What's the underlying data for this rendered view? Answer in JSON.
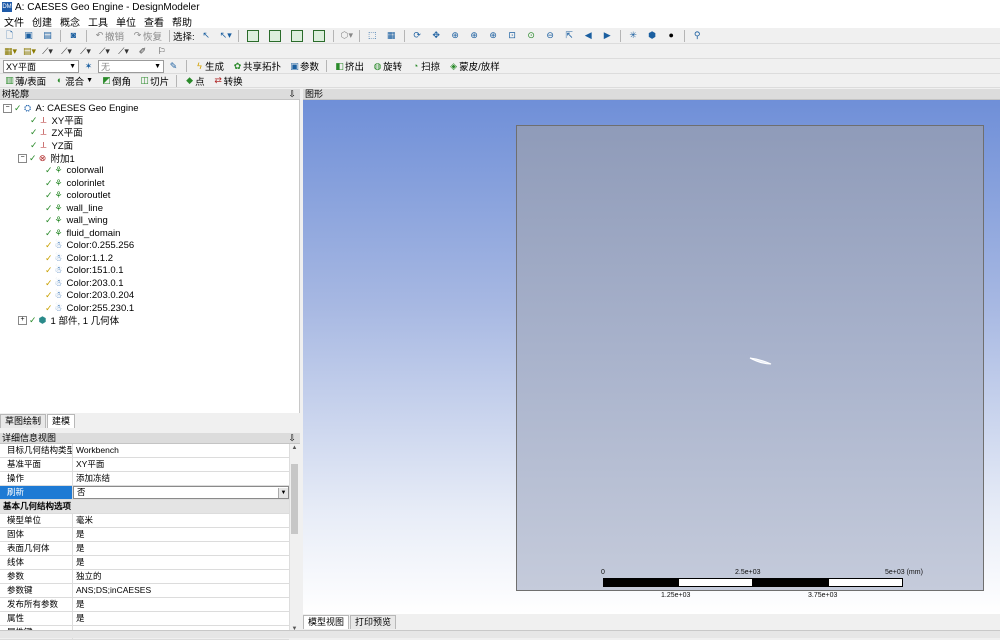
{
  "window": {
    "title": "A: CAESES Geo Engine - DesignModeler",
    "app_icon_text": "DM"
  },
  "menu": [
    "文件",
    "创建",
    "概念",
    "工具",
    "单位",
    "查看",
    "帮助"
  ],
  "toolbar1": {
    "undo_label": "撤销",
    "redo_label": "恢复",
    "select_label": "选择:"
  },
  "toolbar3": {
    "plane_value": "XY平面",
    "sketch_value": "无",
    "generate_label": "生成",
    "share_topology_label": "共享拓扑",
    "parameters_label": "参数",
    "extrude_label": "挤出",
    "revolve_label": "旋转",
    "sweep_label": "扫掠",
    "skin_loft_label": "蒙皮/放样"
  },
  "toolbar4": {
    "thin_surface_label": "薄/表面",
    "blend_label": "混合",
    "chamfer_label": "倒角",
    "slice_label": "切片",
    "point_label": "点",
    "convert_label": "转换"
  },
  "tree": {
    "header": "树轮廓",
    "root": "A: CAESES Geo Engine",
    "planes": [
      "XY平面",
      "ZX平面",
      "YZ面"
    ],
    "attach": "附加1",
    "attach_children": [
      "colorwall",
      "colorinlet",
      "coloroutlet",
      "wall_line",
      "wall_wing",
      "fluid_domain",
      "Color:0.255.256",
      "Color:1.1.2",
      "Color:151.0.1",
      "Color:203.0.1",
      "Color:203.0.204",
      "Color:255.230.1"
    ],
    "parts": "1 部件, 1 几何体"
  },
  "left_tabs": [
    "草图绘制",
    "建模"
  ],
  "details": {
    "header": "详细信息视图",
    "rows": [
      {
        "k": "目标几何结构类型",
        "v": "Workbench"
      },
      {
        "k": "基准平面",
        "v": "XY平面"
      },
      {
        "k": "操作",
        "v": "添加冻结"
      },
      {
        "k": "刷新",
        "v": "否",
        "selected": true
      },
      {
        "group": "基本几何结构选项"
      },
      {
        "k": "模型单位",
        "v": "毫米"
      },
      {
        "k": "固体",
        "v": "是"
      },
      {
        "k": "表面几何体",
        "v": "是"
      },
      {
        "k": "线体",
        "v": "是"
      },
      {
        "k": "参数",
        "v": "独立的"
      },
      {
        "k": "参数键",
        "v": "ANS;DS;inCAESES"
      },
      {
        "k": "发布所有参数",
        "v": "是"
      },
      {
        "k": "属性",
        "v": "是"
      },
      {
        "k": "属性键",
        "v": ""
      }
    ]
  },
  "viewport": {
    "header": "图形",
    "scale": {
      "zero": "0",
      "mid": "2.5e+03",
      "end": "5e+03 (mm)",
      "q1": "1.25e+03",
      "q3": "3.75e+03"
    }
  },
  "bottom_tabs": [
    "模型视图",
    "打印预览"
  ],
  "colors": {
    "viewport_top": "#6f8fd8",
    "selection": "#1e7ad4"
  }
}
